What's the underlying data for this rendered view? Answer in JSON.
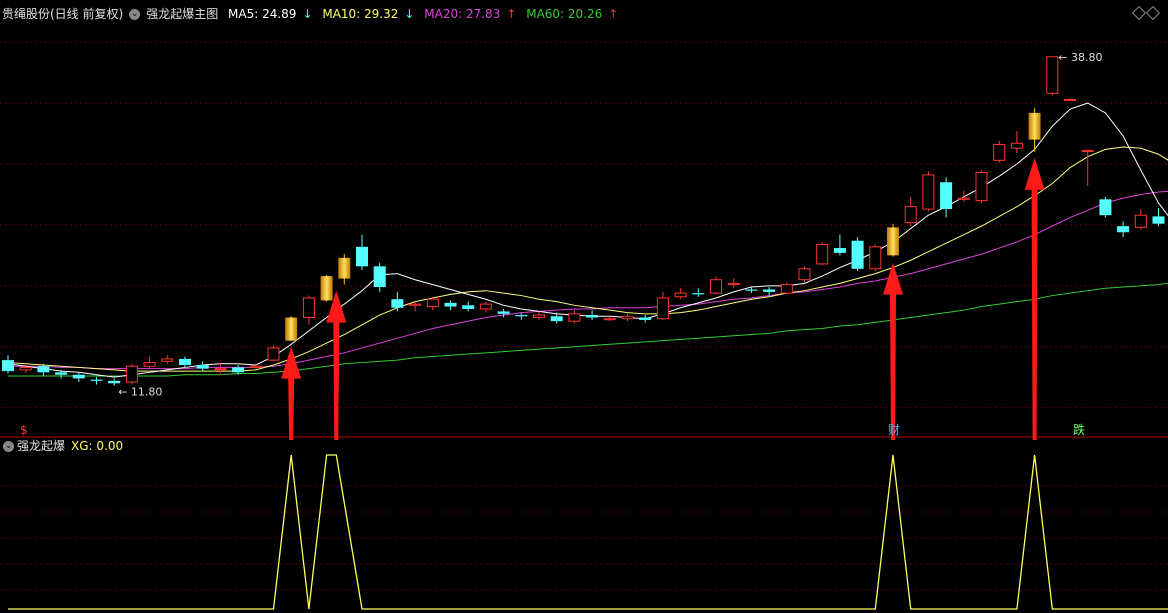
{
  "header": {
    "title": "贵绳股份(日线 前复权)",
    "indicator_name": "强龙起爆主图",
    "ma5": "MA5: 24.89",
    "ma10": "MA10: 29.32",
    "ma20": "MA20: 27.83",
    "ma60": "MA60: 20.26",
    "ma5_arrow": "↓",
    "ma10_arrow": "↓",
    "ma20_arrow": "↑",
    "ma60_arrow": "↑"
  },
  "sub_header": {
    "indicator_name": "强龙起爆",
    "xg": "XG: 0.00"
  },
  "annotations": {
    "high": "38.80",
    "low": "11.80",
    "marker_s": "$",
    "marker_cai": "财",
    "marker_die": "跌"
  },
  "colors": {
    "up": "#ff3232",
    "down": "#54ffff",
    "signal": "#ffc000",
    "ma5": "#ffffff",
    "ma10": "#ffff80",
    "ma20": "#e040e0",
    "ma60": "#33cc33",
    "arrow": "#ff1a1a",
    "xg_line": "#ffff60"
  },
  "chart_data": {
    "type": "candlestick",
    "title": "强龙起爆主图",
    "ylim": [
      8,
      41
    ],
    "grid": true,
    "candles": [
      {
        "o": 13.9,
        "c": 13.0,
        "h": 14.3,
        "l": 12.8
      },
      {
        "o": 13.1,
        "c": 13.3,
        "h": 13.6,
        "l": 12.9
      },
      {
        "o": 13.4,
        "c": 12.9,
        "h": 13.6,
        "l": 12.6
      },
      {
        "o": 12.9,
        "c": 12.7,
        "h": 13.1,
        "l": 12.4
      },
      {
        "o": 12.7,
        "c": 12.4,
        "h": 12.9,
        "l": 12.1
      },
      {
        "o": 12.3,
        "c": 12.2,
        "h": 12.5,
        "l": 11.9
      },
      {
        "o": 12.2,
        "c": 12.0,
        "h": 12.4,
        "l": 11.8
      },
      {
        "o": 12.1,
        "c": 13.4,
        "h": 13.6,
        "l": 11.9
      },
      {
        "o": 13.4,
        "c": 13.7,
        "h": 14.2,
        "l": 13.2
      },
      {
        "o": 13.8,
        "c": 14.0,
        "h": 14.3,
        "l": 13.6
      },
      {
        "o": 14.0,
        "c": 13.5,
        "h": 14.2,
        "l": 13.3
      },
      {
        "o": 13.5,
        "c": 13.2,
        "h": 13.8,
        "l": 13.0
      },
      {
        "o": 13.2,
        "c": 13.2,
        "h": 13.6,
        "l": 12.8
      },
      {
        "o": 13.3,
        "c": 12.9,
        "h": 13.5,
        "l": 12.7
      },
      {
        "o": 13.3,
        "c": 13.4,
        "h": 13.6,
        "l": 13.2
      },
      {
        "o": 13.9,
        "c": 14.9,
        "h": 15.1,
        "l": 13.8
      },
      {
        "o": 15.5,
        "c": 17.4,
        "h": 17.5,
        "l": 15.5,
        "sig": true
      },
      {
        "o": 17.4,
        "c": 19.0,
        "h": 19.2,
        "l": 16.8
      },
      {
        "o": 18.8,
        "c": 20.8,
        "h": 20.9,
        "l": 18.7,
        "sig": true
      },
      {
        "o": 20.6,
        "c": 22.3,
        "h": 22.6,
        "l": 20.1,
        "sig": true
      },
      {
        "o": 23.2,
        "c": 21.6,
        "h": 24.2,
        "l": 21.3
      },
      {
        "o": 21.6,
        "c": 19.9,
        "h": 21.9,
        "l": 19.5
      },
      {
        "o": 18.9,
        "c": 18.2,
        "h": 19.5,
        "l": 17.9
      },
      {
        "o": 18.4,
        "c": 18.5,
        "h": 18.7,
        "l": 17.9
      },
      {
        "o": 18.3,
        "c": 18.9,
        "h": 19.1,
        "l": 18.0
      },
      {
        "o": 18.6,
        "c": 18.3,
        "h": 18.8,
        "l": 18.0
      },
      {
        "o": 18.4,
        "c": 18.1,
        "h": 18.7,
        "l": 17.9
      },
      {
        "o": 18.1,
        "c": 18.5,
        "h": 18.7,
        "l": 17.8
      },
      {
        "o": 17.9,
        "c": 17.7,
        "h": 18.1,
        "l": 17.4
      },
      {
        "o": 17.6,
        "c": 17.5,
        "h": 17.8,
        "l": 17.2
      },
      {
        "o": 17.4,
        "c": 17.6,
        "h": 17.9,
        "l": 17.2
      },
      {
        "o": 17.5,
        "c": 17.1,
        "h": 17.8,
        "l": 16.9
      },
      {
        "o": 17.1,
        "c": 17.7,
        "h": 18.0,
        "l": 16.9
      },
      {
        "o": 17.6,
        "c": 17.4,
        "h": 18.0,
        "l": 17.2
      },
      {
        "o": 17.3,
        "c": 17.3,
        "h": 17.5,
        "l": 17.1
      },
      {
        "o": 17.3,
        "c": 17.5,
        "h": 17.7,
        "l": 17.1
      },
      {
        "o": 17.4,
        "c": 17.2,
        "h": 17.6,
        "l": 17.0
      },
      {
        "o": 17.3,
        "c": 19.0,
        "h": 19.5,
        "l": 17.2
      },
      {
        "o": 19.1,
        "c": 19.4,
        "h": 19.8,
        "l": 18.9
      },
      {
        "o": 19.4,
        "c": 19.3,
        "h": 19.8,
        "l": 19.1
      },
      {
        "o": 19.4,
        "c": 20.5,
        "h": 20.8,
        "l": 19.3
      },
      {
        "o": 20.1,
        "c": 20.2,
        "h": 20.6,
        "l": 19.8
      },
      {
        "o": 19.7,
        "c": 19.6,
        "h": 19.9,
        "l": 19.4
      },
      {
        "o": 19.7,
        "c": 19.5,
        "h": 19.9,
        "l": 19.2
      },
      {
        "o": 19.4,
        "c": 20.1,
        "h": 20.3,
        "l": 19.3
      },
      {
        "o": 20.5,
        "c": 21.4,
        "h": 21.6,
        "l": 20.3
      },
      {
        "o": 21.8,
        "c": 23.4,
        "h": 23.6,
        "l": 21.7
      },
      {
        "o": 23.1,
        "c": 22.7,
        "h": 24.2,
        "l": 22.5
      },
      {
        "o": 23.7,
        "c": 21.4,
        "h": 24.0,
        "l": 21.2
      },
      {
        "o": 21.4,
        "c": 23.2,
        "h": 23.4,
        "l": 21.2
      },
      {
        "o": 22.5,
        "c": 24.8,
        "h": 25.1,
        "l": 22.4,
        "sig": true
      },
      {
        "o": 25.2,
        "c": 26.5,
        "h": 27.3,
        "l": 24.9
      },
      {
        "o": 26.3,
        "c": 29.1,
        "h": 29.4,
        "l": 26.1
      },
      {
        "o": 28.5,
        "c": 26.3,
        "h": 28.9,
        "l": 25.6
      },
      {
        "o": 27.1,
        "c": 27.2,
        "h": 27.8,
        "l": 26.9
      },
      {
        "o": 27.0,
        "c": 29.3,
        "h": 29.5,
        "l": 26.8
      },
      {
        "o": 30.3,
        "c": 31.6,
        "h": 31.9,
        "l": 30.1
      },
      {
        "o": 31.3,
        "c": 31.7,
        "h": 32.7,
        "l": 30.9
      },
      {
        "o": 32.0,
        "c": 34.2,
        "h": 34.6,
        "l": 31.0,
        "sig": true
      },
      {
        "o": 35.8,
        "c": 38.8,
        "h": 38.8,
        "l": 35.6
      },
      {
        "o": 35.3,
        "c": 35.3,
        "h": 35.4,
        "l": 35.2
      },
      {
        "o": 31.1,
        "c": 31.1,
        "h": 31.2,
        "l": 28.2
      },
      {
        "o": 27.1,
        "c": 25.8,
        "h": 27.3,
        "l": 25.6
      },
      {
        "o": 24.9,
        "c": 24.4,
        "h": 25.3,
        "l": 24.0
      },
      {
        "o": 24.8,
        "c": 25.8,
        "h": 26.3,
        "l": 24.6
      },
      {
        "o": 25.7,
        "c": 25.1,
        "h": 26.4,
        "l": 24.9
      },
      {
        "o": 24.4,
        "c": 23.6,
        "h": 24.8,
        "l": 22.9
      }
    ],
    "ma5": [
      13.6,
      13.4,
      13.2,
      13.0,
      12.9,
      12.7,
      12.5,
      12.7,
      12.9,
      13.1,
      13.3,
      13.5,
      13.6,
      13.6,
      13.5,
      14.2,
      15.2,
      16.3,
      17.4,
      18.5,
      19.6,
      20.9,
      21.0,
      20.5,
      20.1,
      19.7,
      19.3,
      18.9,
      18.4,
      18.1,
      17.9,
      17.7,
      17.6,
      17.5,
      17.5,
      17.4,
      17.3,
      17.7,
      18.2,
      18.6,
      19.0,
      19.5,
      19.9,
      20.0,
      20.0,
      20.2,
      20.8,
      21.5,
      22.1,
      22.8,
      23.6,
      24.7,
      25.8,
      26.5,
      27.3,
      28.1,
      29.0,
      30.0,
      31.2,
      33.1,
      34.5,
      35.0,
      34.2,
      32.3,
      29.5,
      26.8,
      24.9
    ],
    "ma10": [
      13.7,
      13.6,
      13.5,
      13.4,
      13.3,
      13.2,
      13.1,
      13.0,
      13.0,
      13.0,
      13.0,
      13.0,
      13.0,
      13.0,
      13.1,
      13.5,
      14.0,
      14.6,
      15.3,
      16.0,
      16.8,
      17.6,
      18.2,
      18.7,
      19.0,
      19.3,
      19.5,
      19.6,
      19.4,
      19.2,
      18.9,
      18.7,
      18.4,
      18.2,
      18.0,
      17.8,
      17.7,
      17.7,
      17.8,
      18.0,
      18.3,
      18.6,
      18.9,
      19.1,
      19.4,
      19.6,
      19.9,
      20.2,
      20.6,
      21.0,
      21.5,
      22.1,
      22.8,
      23.5,
      24.2,
      24.9,
      25.7,
      26.5,
      27.4,
      28.4,
      29.7,
      30.6,
      31.2,
      31.4,
      31.3,
      30.8,
      29.9
    ],
    "ma20": [
      13.4,
      13.4,
      13.4,
      13.3,
      13.3,
      13.2,
      13.2,
      13.2,
      13.2,
      13.2,
      13.2,
      13.3,
      13.3,
      13.3,
      13.3,
      13.4,
      13.6,
      13.9,
      14.2,
      14.5,
      14.9,
      15.3,
      15.7,
      16.1,
      16.5,
      16.8,
      17.1,
      17.4,
      17.6,
      17.8,
      17.9,
      18.0,
      18.1,
      18.1,
      18.2,
      18.2,
      18.2,
      18.3,
      18.4,
      18.5,
      18.7,
      18.9,
      19.0,
      19.2,
      19.4,
      19.5,
      19.7,
      19.9,
      20.2,
      20.4,
      20.7,
      21.0,
      21.4,
      21.8,
      22.2,
      22.6,
      23.1,
      23.6,
      24.2,
      24.9,
      25.6,
      26.2,
      26.8,
      27.2,
      27.5,
      27.7,
      27.8
    ],
    "ma60": [
      12.6,
      12.6,
      12.6,
      12.6,
      12.6,
      12.6,
      12.6,
      12.6,
      12.6,
      12.6,
      12.7,
      12.7,
      12.7,
      12.8,
      12.8,
      12.9,
      13.0,
      13.2,
      13.4,
      13.6,
      13.7,
      13.8,
      13.9,
      14.1,
      14.2,
      14.3,
      14.4,
      14.5,
      14.6,
      14.7,
      14.8,
      14.9,
      15.0,
      15.1,
      15.2,
      15.3,
      15.4,
      15.5,
      15.6,
      15.7,
      15.8,
      15.9,
      16.0,
      16.1,
      16.3,
      16.4,
      16.5,
      16.7,
      16.8,
      17.0,
      17.2,
      17.4,
      17.6,
      17.8,
      18.0,
      18.3,
      18.5,
      18.7,
      18.9,
      19.2,
      19.4,
      19.6,
      19.8,
      19.9,
      20.0,
      20.1,
      20.3
    ],
    "xg": [
      0,
      0,
      0,
      0,
      0,
      0,
      0,
      0,
      0,
      0,
      0,
      0,
      0,
      0,
      0,
      0,
      1,
      0,
      1,
      1,
      0,
      0,
      0,
      0,
      0,
      0,
      0,
      0,
      0,
      0,
      0,
      0,
      0,
      0,
      0,
      0,
      0,
      0,
      0,
      0,
      0,
      0,
      0,
      0,
      0,
      0,
      0,
      0,
      0,
      0,
      1,
      0,
      0,
      0,
      0,
      0,
      0,
      0,
      1,
      0,
      0,
      0,
      0,
      0,
      0,
      0,
      0
    ],
    "signal_arrows": [
      16,
      19,
      50,
      58
    ]
  }
}
